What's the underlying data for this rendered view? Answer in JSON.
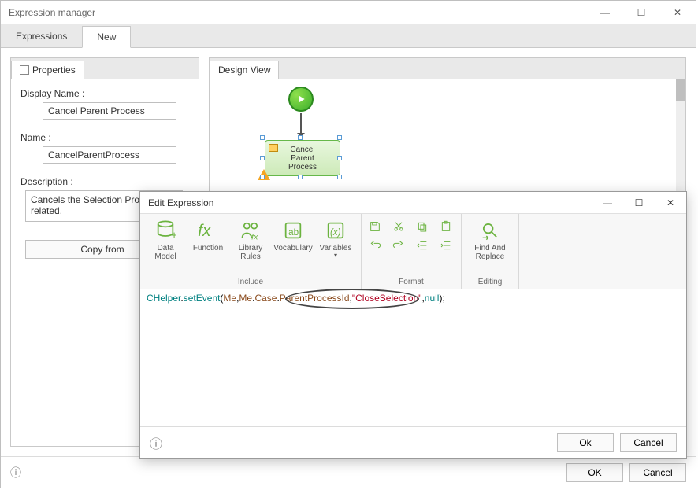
{
  "window": {
    "title": "Expression manager",
    "tabs": {
      "expressions": "Expressions",
      "new": "New"
    }
  },
  "properties": {
    "tab_label": "Properties",
    "display_name_label": "Display Name :",
    "display_name_value": "Cancel Parent Process",
    "name_label": "Name :",
    "name_value": "CancelParentProcess",
    "description_label": "Description :",
    "description_value": "Cancels the Selection Process related.",
    "copy_from": "Copy from"
  },
  "design_view": {
    "tab_label": "Design View",
    "node_label": "Cancel\nParent\nProcess"
  },
  "footer": {
    "ok": "OK",
    "cancel": "Cancel"
  },
  "dialog": {
    "title": "Edit Expression",
    "ribbon": {
      "include_label": "Include",
      "data_model": "Data\nModel",
      "function": "Function",
      "library_rules": "Library\nRules",
      "vocabulary": "Vocabulary",
      "variables": "Variables",
      "format_label": "Format",
      "editing_label": "Editing",
      "find_replace": "Find And\nReplace"
    },
    "code": {
      "p1": "CHelper",
      "p2": ".",
      "p3": "setEvent",
      "p4": "(",
      "p5": "Me",
      "p6": ",",
      "p7": "Me",
      "p8": ".",
      "p9": "Case",
      "p10": ".",
      "p11": "ParentProcessId",
      "p12": ",",
      "p13": "\"CloseSelection\"",
      "p14": ",",
      "p15": "null",
      "p16": ");"
    },
    "footer": {
      "ok": "Ok",
      "cancel": "Cancel"
    }
  }
}
